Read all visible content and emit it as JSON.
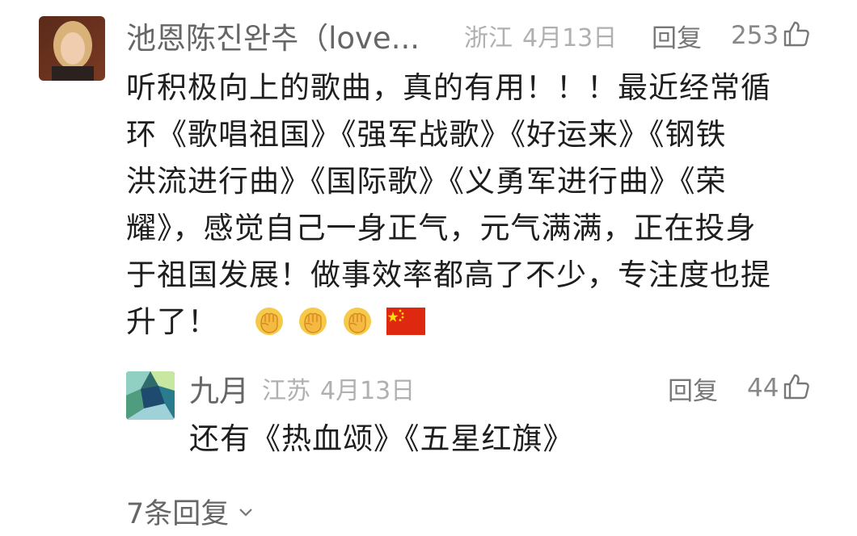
{
  "comment": {
    "username": "池恩陈진완추（love...",
    "region": "浙江",
    "date": "4月13日",
    "reply_label": "回复",
    "like_count": "253",
    "text_lines": [
      "听积极向上的歌曲，真的有用！！！最近经常循",
      "环《歌唱祖国》《强军战歌》《好运来》《钢铁",
      "洪流进行曲》《国际歌》《义勇军进行曲》《荣",
      "耀》，感觉自己一身正气，元气满满，正在投身",
      "于祖国发展！做事效率都高了不少，专注度也提"
    ],
    "last_line_text": "升了！",
    "emoji": [
      "raised-fist",
      "raised-fist",
      "raised-fist",
      "china-flag"
    ]
  },
  "reply": {
    "username": "九月",
    "region": "江苏",
    "date": "4月13日",
    "reply_label": "回复",
    "like_count": "44",
    "text": "还有《热血颂》《五星红旗》"
  },
  "more_replies": {
    "label": "7条回复"
  },
  "colors": {
    "username": "#666666",
    "meta": "#b0b0b0",
    "body_text": "#1e1e1e",
    "flag_red": "#de2910",
    "flag_star": "#ffde00"
  }
}
